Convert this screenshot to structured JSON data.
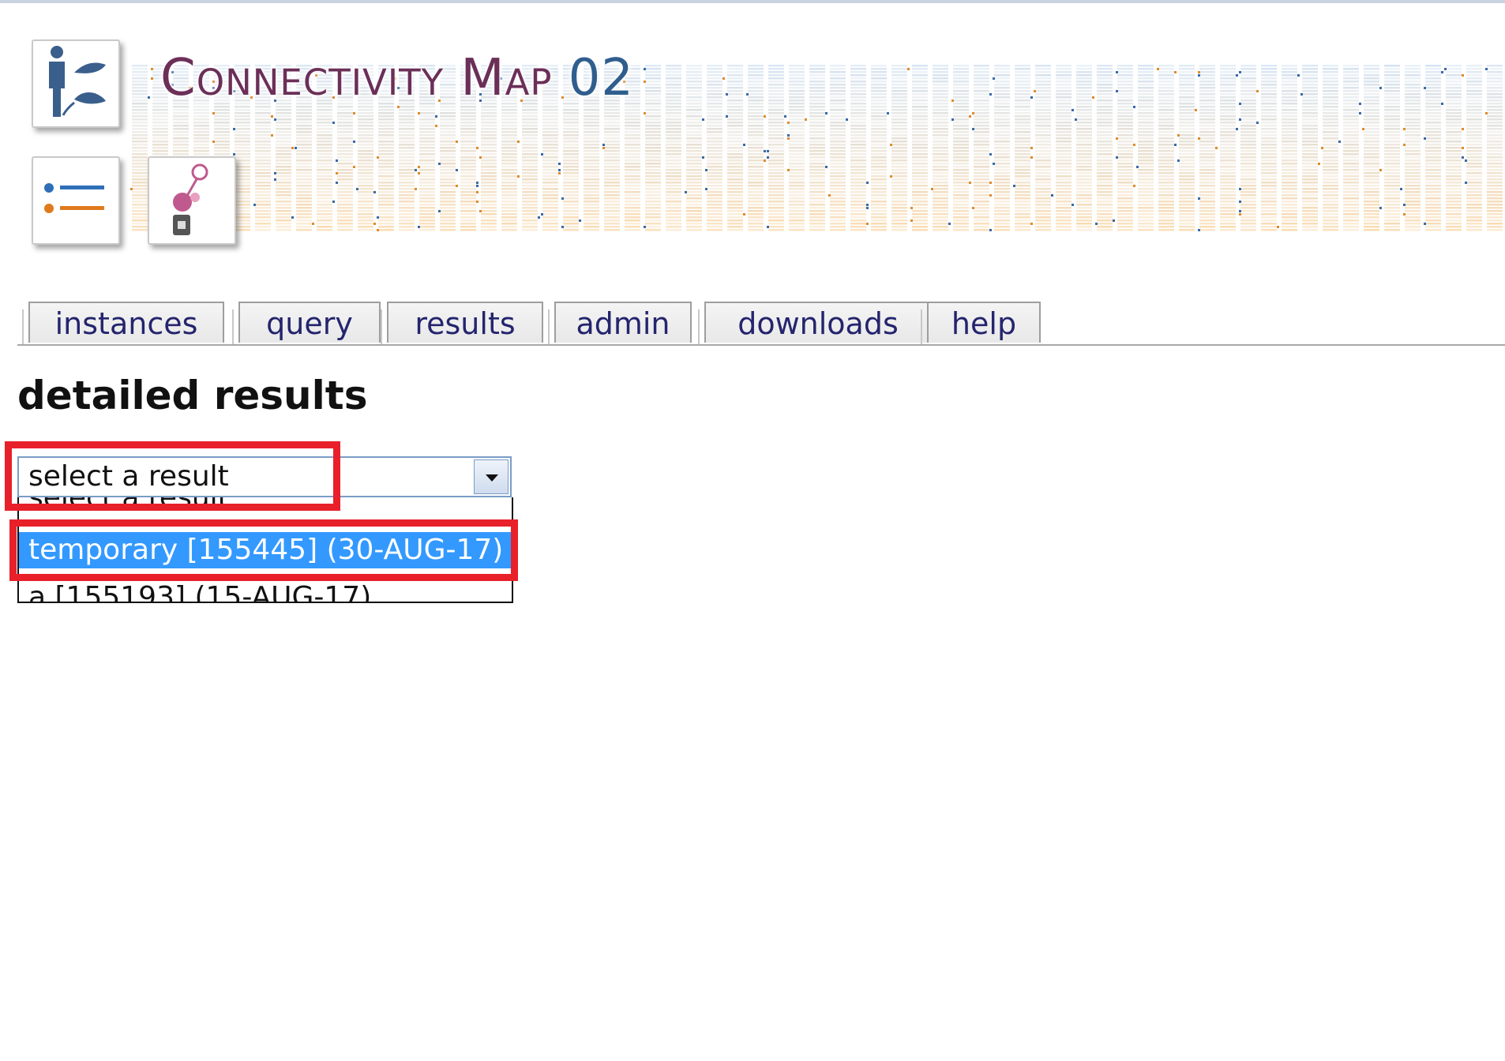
{
  "banner": {
    "title": "Connectivity Map",
    "version": "02"
  },
  "tabs": [
    {
      "label": "instances"
    },
    {
      "label": "query"
    },
    {
      "label": "results"
    },
    {
      "label": "admin"
    },
    {
      "label": "downloads"
    },
    {
      "label": "help"
    }
  ],
  "page": {
    "title": "detailed results"
  },
  "select": {
    "value": "select a result",
    "options": [
      {
        "label": "select a result"
      },
      {
        "label": "temporary [155445] (30-AUG-17)",
        "selected": true
      },
      {
        "label": "a [155193] (15-AUG-17)"
      }
    ]
  },
  "colors": {
    "accent_highlight": "#e8202a",
    "selected_option_bg": "#3399ff",
    "tab_text": "#24246e",
    "title_purple": "#6b2f58",
    "title_blue": "#2f5e8e"
  },
  "icons": [
    "person-mouse-icon",
    "list-icon",
    "molecule-icon",
    "dropdown-arrow-icon"
  ]
}
